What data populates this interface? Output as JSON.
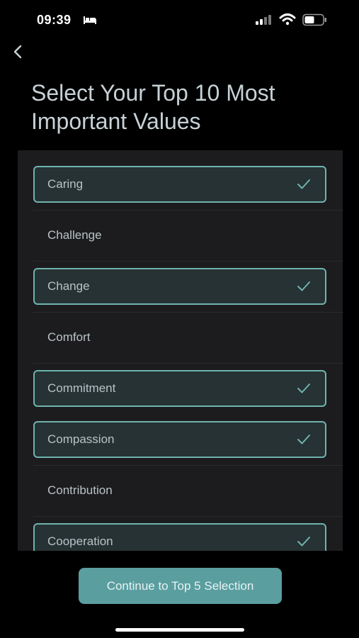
{
  "status_bar": {
    "time": "09:39",
    "icons": [
      "bed-icon",
      "signal-icon",
      "wifi-icon",
      "battery-icon"
    ]
  },
  "header": {
    "back_icon": "chevron-left-icon",
    "title": "Select Your Top 10 Most Important Values"
  },
  "values": [
    {
      "label": "Caring",
      "selected": true
    },
    {
      "label": "Challenge",
      "selected": false
    },
    {
      "label": "Change",
      "selected": true
    },
    {
      "label": "Comfort",
      "selected": false
    },
    {
      "label": "Commitment",
      "selected": true
    },
    {
      "label": "Compassion",
      "selected": true
    },
    {
      "label": "Contribution",
      "selected": false
    },
    {
      "label": "Cooperation",
      "selected": true
    }
  ],
  "footer": {
    "continue_label": "Continue to Top 5 Selection"
  },
  "colors": {
    "background": "#000000",
    "panel": "#1c1c1e",
    "selected_fill": "#263234",
    "accent": "#6fb3ae",
    "button": "#5a9ea0"
  }
}
